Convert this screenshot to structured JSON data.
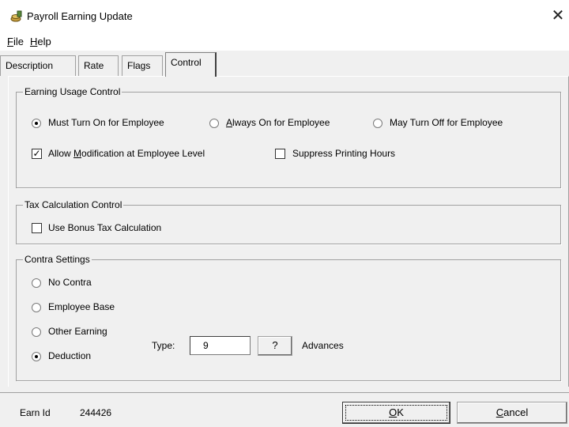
{
  "window": {
    "title": "Payroll Earning Update"
  },
  "menu": {
    "file": "File",
    "help": "Help"
  },
  "tabs": [
    "Description",
    "Rate",
    "Flags",
    "Control"
  ],
  "earning_usage": {
    "legend": "Earning Usage Control",
    "options": [
      "Must Turn On for Employee",
      "Always On for Employee",
      "May Turn Off for Employee"
    ],
    "selected": "Must Turn On for Employee",
    "allow_modification": {
      "label": "Allow Modification at Employee Level",
      "checked": true
    },
    "suppress_printing": {
      "label": "Suppress Printing Hours",
      "checked": false
    }
  },
  "tax_calc": {
    "legend": "Tax Calculation Control",
    "use_bonus": {
      "label": "Use Bonus Tax Calculation",
      "checked": false
    }
  },
  "contra": {
    "legend": "Contra Settings",
    "options": [
      "No Contra",
      "Employee Base",
      "Other Earning",
      "Deduction"
    ],
    "selected": "Deduction",
    "type_label": "Type:",
    "type_value": "9",
    "lookup_label": "?",
    "type_description": "Advances"
  },
  "status": {
    "earn_id_label": "Earn Id",
    "earn_id_value": "244426"
  },
  "buttons": {
    "ok": "OK",
    "cancel": "Cancel"
  }
}
